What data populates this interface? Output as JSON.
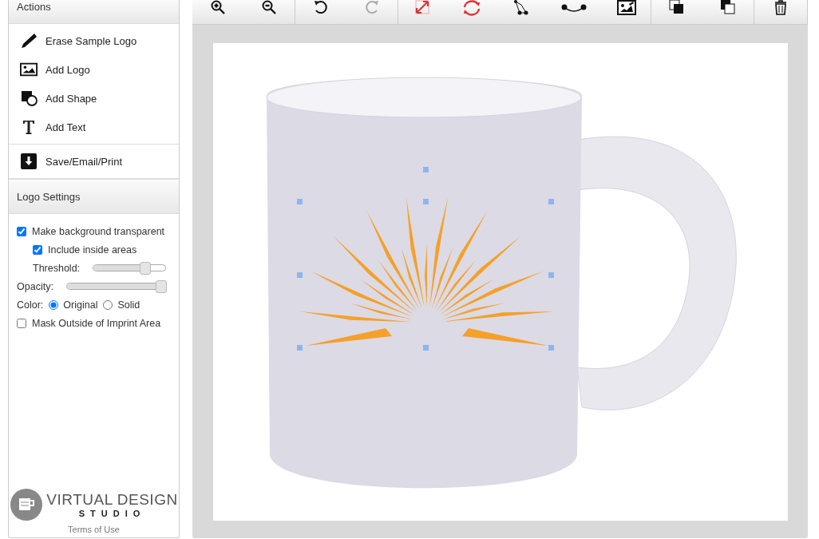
{
  "actions": {
    "title": "Actions",
    "items": [
      {
        "kind": "erase",
        "label": "Erase Sample Logo"
      },
      {
        "kind": "logo",
        "label": "Add Logo"
      },
      {
        "kind": "shape",
        "label": "Add Shape"
      },
      {
        "kind": "text",
        "label": "Add Text"
      }
    ],
    "save": {
      "kind": "save",
      "label": "Save/Email/Print"
    }
  },
  "logo_settings": {
    "title": "Logo Settings",
    "transparent": {
      "label": "Make background transparent",
      "checked": true
    },
    "inside": {
      "label": "Include inside areas",
      "checked": true
    },
    "threshold": {
      "label": "Threshold:",
      "level": 0.75
    },
    "opacity": {
      "label": "Opacity:",
      "level": 1.0
    },
    "color": {
      "label": "Color:",
      "options": [
        {
          "label": "Original",
          "selected": true
        },
        {
          "label": "Solid",
          "selected": false
        }
      ]
    },
    "mask": {
      "label": "Mask Outside of Imprint Area",
      "checked": false
    }
  },
  "brand": {
    "name": "VIRTUAL DESIGN",
    "sub": "STUDIO",
    "link": "Terms of Use"
  },
  "toolbar": [
    [
      {
        "kind": "zoom-in",
        "disabled": false
      },
      {
        "kind": "zoom-out",
        "disabled": false
      }
    ],
    [
      {
        "kind": "undo",
        "disabled": false
      },
      {
        "kind": "redo",
        "disabled": true
      }
    ],
    [
      {
        "kind": "resize",
        "disabled": false
      },
      {
        "kind": "rotate",
        "disabled": false
      },
      {
        "kind": "nodes",
        "disabled": false
      },
      {
        "kind": "curve",
        "disabled": false
      },
      {
        "kind": "image",
        "disabled": false
      }
    ],
    [
      {
        "kind": "front",
        "disabled": false
      },
      {
        "kind": "back",
        "disabled": false
      }
    ],
    [
      {
        "kind": "delete",
        "disabled": false
      }
    ]
  ]
}
